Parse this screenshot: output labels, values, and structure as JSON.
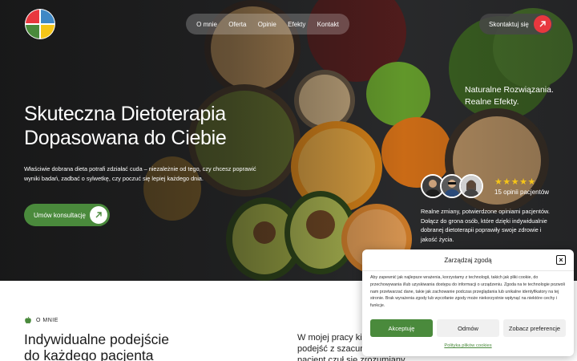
{
  "nav": {
    "items": [
      "O mnie",
      "Oferta",
      "Opinie",
      "Efekty",
      "Kontakt"
    ],
    "contact_label": "Skontaktuj się"
  },
  "hero": {
    "title_line1": "Skuteczna Dietoterapia",
    "title_line2": "Dopasowana do Ciebie",
    "description": "Właściwie dobrana dieta potrafi zdziałać cuda – niezależnie od tego, czy chcesz poprawić wyniki badań, zadbać o sylwetkę, czy poczuć się lepiej każdego dnia.",
    "cta_label": "Umów konsultację",
    "tagline_line1": "Naturalne Rozwiązania.",
    "tagline_line2": "Realne Efekty.",
    "stars": "★★★★★",
    "reviews_count": "15 opinii pacjentów",
    "social_proof": "Realne zmiany, potwierdzone opiniami pacjentów. Dołącz do grona osób, które dzięki indywidualnie dobranej dietoterapii poprawiły swoje zdrowie i jakość życia."
  },
  "about": {
    "eyebrow": "O MNIE",
    "heading_line1": "Indywidualne podejście",
    "heading_line2": "do każdego pacjenta",
    "text": "W mojej pracy kieruję się zasadą, że do drugiego człowieka trzeba podejść z szacunkiem do jego potrzeb. Zależy mi na tym, by pacjent czuł się zrozumiany"
  },
  "cookie": {
    "title": "Zarządzaj zgodą",
    "close": "×",
    "body": "Aby zapewnić jak najlepsze wrażenia, korzystamy z technologii, takich jak pliki cookie, do przechowywania i/lub uzyskiwania dostępu do informacji o urządzeniu. Zgoda na te technologie pozwoli nam przetwarzać dane, takie jak zachowanie podczas przeglądania lub unikalne identyfikatory na tej stronie. Brak wyrażenia zgody lub wycofanie zgody może niekorzystnie wpłynąć na niektóre cechy i funkcje.",
    "accept": "Akceptuję",
    "deny": "Odmów",
    "prefs": "Zobacz preferencje",
    "policy_link": "Polityka plików cookies"
  },
  "colors": {
    "accent_green": "#4a8a3c",
    "accent_red": "#e8373e",
    "star_yellow": "#f5c518"
  },
  "icons": {
    "logo": "colorful-plate-logo-icon",
    "arrow": "arrow-up-right-icon",
    "apple": "apple-icon"
  }
}
